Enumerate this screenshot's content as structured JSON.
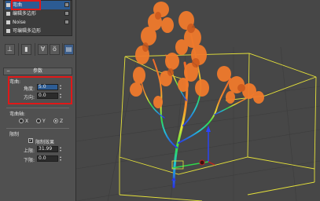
{
  "modifier_stack": {
    "items": [
      {
        "label": "弯曲",
        "selected": true
      },
      {
        "label": "编辑多边形",
        "selected": false
      },
      {
        "label": "Noise",
        "selected": false
      },
      {
        "label": "可编辑多边形",
        "selected": false
      }
    ]
  },
  "rollout": {
    "title": "参数",
    "collapse_symbol": "−",
    "bend_group": "弯曲:",
    "angle_label": "角度:",
    "angle_value": "5.0",
    "direction_label": "方向:",
    "direction_value": "0.0",
    "axis_group": "弯曲轴:",
    "axis_x": "X",
    "axis_y": "Y",
    "axis_z": "Z",
    "axis_selected": "Z",
    "limits_group": "限制",
    "limit_effect_label": "限制效果",
    "limit_effect_checked": true,
    "upper_label": "上限:",
    "upper_value": "31.99",
    "lower_label": "下限:",
    "lower_value": "0.0"
  },
  "toolbar": {
    "icons": [
      "pin-icon",
      "show-end-result-icon",
      "make-unique-icon",
      "remove-modifier-icon",
      "configure-sets-icon"
    ]
  },
  "colors": {
    "selection_highlight": "#2c5b93",
    "annotation_red": "#e01818",
    "gizmo_yellow": "#e6e23a",
    "foliage_orange": "#f07a2c"
  }
}
